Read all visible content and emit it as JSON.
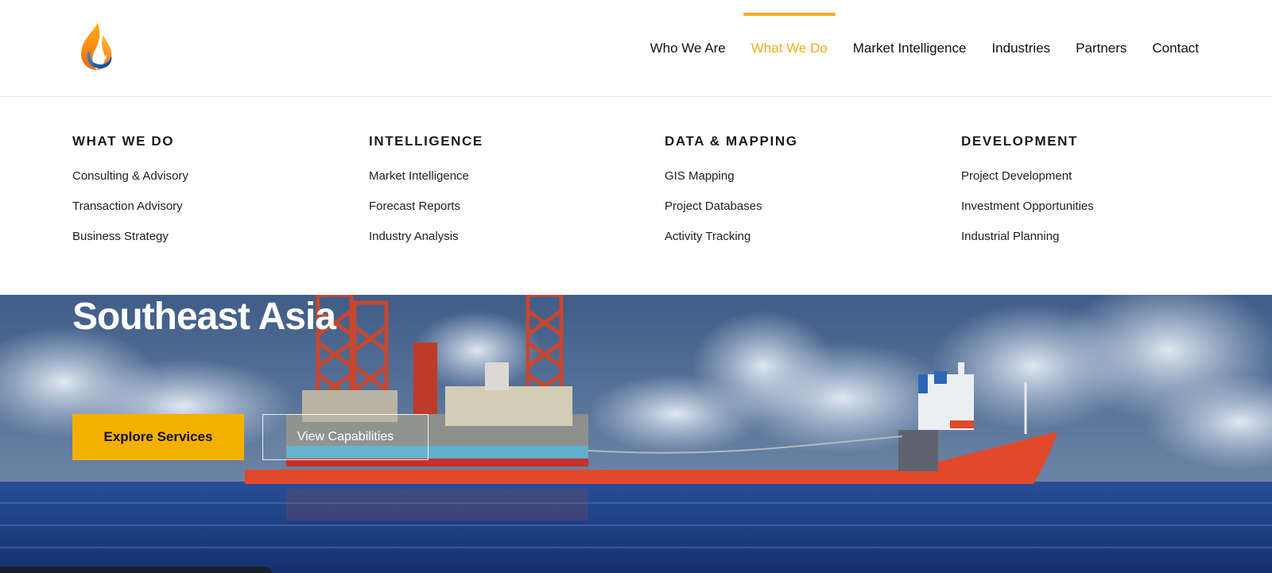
{
  "header": {
    "logo_icon": "flame-drop-logo-icon",
    "nav": [
      {
        "label": "Who We Are",
        "active": false
      },
      {
        "label": "What We Do",
        "active": true
      },
      {
        "label": "Market Intelligence",
        "active": false
      },
      {
        "label": "Industries",
        "active": false
      },
      {
        "label": "Partners",
        "active": false
      },
      {
        "label": "Contact",
        "active": false
      }
    ]
  },
  "mega_menu": {
    "columns": [
      {
        "heading": "WHAT WE DO",
        "links": [
          "Consulting & Advisory",
          "Transaction Advisory",
          "Business Strategy"
        ]
      },
      {
        "heading": "INTELLIGENCE",
        "links": [
          "Market Intelligence",
          "Forecast Reports",
          "Industry Analysis"
        ]
      },
      {
        "heading": "DATA & MAPPING",
        "links": [
          "GIS Mapping",
          "Project Databases",
          "Activity Tracking"
        ]
      },
      {
        "heading": "DEVELOPMENT",
        "links": [
          "Project Development",
          "Investment Opportunities",
          "Industrial Planning"
        ]
      }
    ]
  },
  "hero": {
    "title_line": "Southeast Asia",
    "primary_button": "Explore Services",
    "secondary_button": "View Capabilities"
  },
  "colors": {
    "accent": "#f2ad1e",
    "button_primary": "#f4b000",
    "text_dark": "#111111",
    "sea": "#1e3f86",
    "sky": "#4a6690",
    "vessel_hull": "#e2492a"
  }
}
